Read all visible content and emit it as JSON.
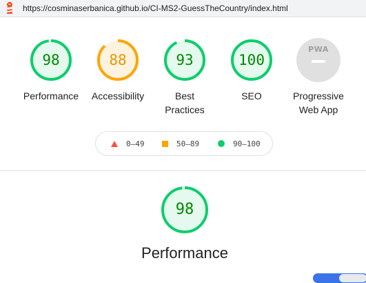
{
  "browser": {
    "url": "https://cosminaserbanica.github.io/CI-MS2-GuessTheCountry/index.html"
  },
  "categories": [
    {
      "label": "Performance",
      "score": "98",
      "fraction": 0.98,
      "color": "#0cce6b",
      "text_color": "#008800",
      "bg": "#e5f9ee"
    },
    {
      "label": "Accessibility",
      "score": "88",
      "fraction": 0.88,
      "color": "#ffa400",
      "text_color": "#e69500",
      "bg": "#fff3e0"
    },
    {
      "label_line1": "Best",
      "label_line2": "Practices",
      "score": "93",
      "fraction": 0.93,
      "color": "#0cce6b",
      "text_color": "#008800",
      "bg": "#e5f9ee"
    },
    {
      "label": "SEO",
      "score": "100",
      "fraction": 1.0,
      "color": "#0cce6b",
      "text_color": "#008800",
      "bg": "#e5f9ee"
    }
  ],
  "pwa": {
    "badge_text": "PWA",
    "label_line1": "Progressive",
    "label_line2": "Web App"
  },
  "legend": {
    "fail": "0–49",
    "average": "50–89",
    "pass": "90–100"
  },
  "detail": {
    "score": "98",
    "fraction": 0.98,
    "title": "Performance"
  }
}
